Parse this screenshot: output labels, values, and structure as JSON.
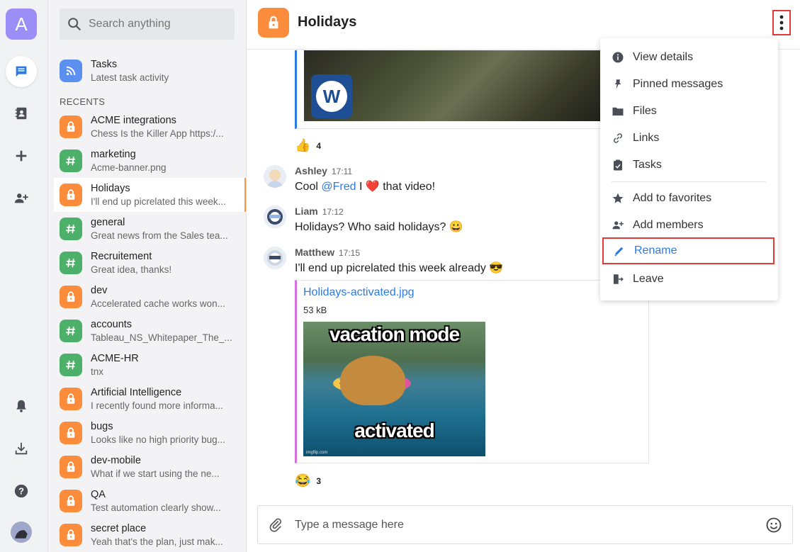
{
  "workspace": {
    "initial": "A"
  },
  "search": {
    "placeholder": "Search anything"
  },
  "pinned": {
    "name": "Tasks",
    "preview": "Latest task activity"
  },
  "recents_label": "RECENTS",
  "channels": [
    {
      "name": "ACME integrations",
      "preview": "Chess Is the Killer App https:/...",
      "type": "private"
    },
    {
      "name": "marketing",
      "preview": "Acme-banner.png",
      "type": "public"
    },
    {
      "name": "Holidays",
      "preview": "I'll end up picrelated this week...",
      "type": "private",
      "active": true
    },
    {
      "name": "general",
      "preview": "Great news from the Sales tea...",
      "type": "public"
    },
    {
      "name": "Recruitement",
      "preview": "Great idea, thanks!",
      "type": "public"
    },
    {
      "name": "dev",
      "preview": "Accelerated cache works won...",
      "type": "private"
    },
    {
      "name": "accounts",
      "preview": "Tableau_NS_Whitepaper_The_...",
      "type": "public"
    },
    {
      "name": "ACME-HR",
      "preview": "tnx",
      "type": "public"
    },
    {
      "name": "Artificial Intelligence",
      "preview": "I recently found more informa...",
      "type": "private"
    },
    {
      "name": "bugs",
      "preview": "Looks like no high priority bug...",
      "type": "private"
    },
    {
      "name": "dev-mobile",
      "preview": "What if we start using the ne...",
      "type": "private"
    },
    {
      "name": "QA",
      "preview": "Test automation clearly show...",
      "type": "private"
    },
    {
      "name": "secret place",
      "preview": "Yeah that's the plan, just mak...",
      "type": "private"
    }
  ],
  "header": {
    "title": "Holidays"
  },
  "reactions": {
    "top": {
      "emoji": "👍",
      "count": "4"
    },
    "bottom": {
      "emoji": "😂",
      "count": "3"
    }
  },
  "messages": [
    {
      "author": "Ashley",
      "time": "17:11",
      "pre": "Cool ",
      "mention": "@Fred",
      "post": " I ❤️ that video!"
    },
    {
      "author": "Liam",
      "time": "17:12",
      "text": "Holidays? Who said holidays? 😀"
    },
    {
      "author": "Matthew",
      "time": "17:15",
      "text": "I'll end up picrelated this week already 😎"
    }
  ],
  "attachment": {
    "filename": "Holidays-activated.jpg",
    "size": "53 kB",
    "caption_top": "vacation mode",
    "caption_bottom": "activated",
    "watermark": "imgflip.com"
  },
  "composer": {
    "placeholder": "Type a message here"
  },
  "menu": {
    "items": [
      {
        "label": "View details",
        "icon": "info-icon"
      },
      {
        "label": "Pinned messages",
        "icon": "pin-icon"
      },
      {
        "label": "Files",
        "icon": "folder-icon"
      },
      {
        "label": "Links",
        "icon": "link-icon"
      },
      {
        "label": "Tasks",
        "icon": "clipboard-icon"
      },
      {
        "label": "Add to favorites",
        "icon": "star-icon"
      },
      {
        "label": "Add members",
        "icon": "add-user-icon"
      },
      {
        "label": "Rename",
        "icon": "pencil-icon",
        "highlighted": true
      },
      {
        "label": "Leave",
        "icon": "exit-icon"
      }
    ]
  },
  "colors": {
    "accent": "#2c7be5",
    "private": "#fb8c3c",
    "public": "#4caf6a",
    "highlight": "#e53935"
  }
}
